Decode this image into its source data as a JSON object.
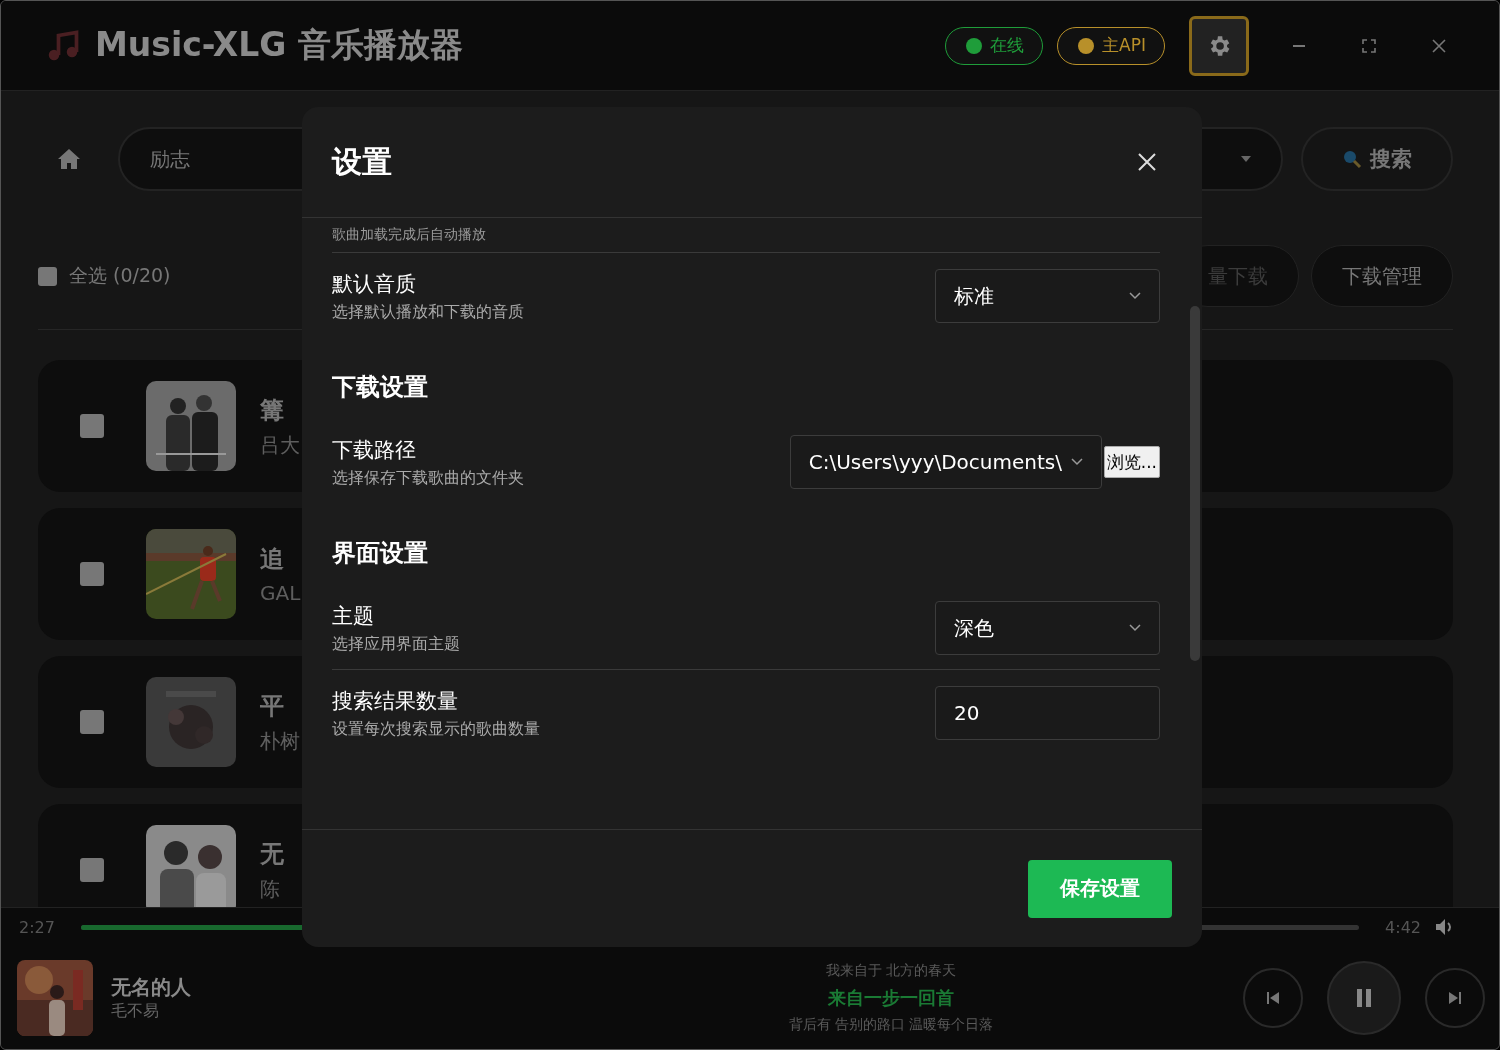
{
  "window": {
    "title": "Music-XLG 音乐播放器",
    "status": [
      {
        "label": "在线",
        "color": "#1f9d3a"
      },
      {
        "label": "主API",
        "color": "#b8902a"
      }
    ]
  },
  "search": {
    "query": "励志",
    "button": "搜索"
  },
  "toolbar": {
    "select_all": {
      "label": "全选 (0/20)",
      "checked": false
    },
    "buttons": [
      "量下载",
      "下载管理"
    ]
  },
  "songs": [
    {
      "title": "篝",
      "artist": "吕大",
      "checked": false
    },
    {
      "title": "追",
      "artist": "GAL",
      "checked": false
    },
    {
      "title": "平",
      "artist": "朴树",
      "checked": false
    },
    {
      "title": "无",
      "artist": "陈",
      "checked": false
    }
  ],
  "settings": {
    "title": "设置",
    "partial_note": "歌曲加载完成后自动播放",
    "sections": [
      {
        "rows": [
          {
            "kind": "select",
            "label": "默认音质",
            "description": "选择默认播放和下载的音质",
            "value": "标准"
          }
        ]
      },
      {
        "heading": "下载设置",
        "rows": [
          {
            "kind": "path",
            "label": "下载路径",
            "description": "选择保存下载歌曲的文件夹",
            "value": "C:\\Users\\yyy\\Documents\\",
            "button": "浏览..."
          }
        ]
      },
      {
        "heading": "界面设置",
        "rows": [
          {
            "kind": "select",
            "label": "主题",
            "description": "选择应用界面主题",
            "value": "深色"
          },
          {
            "kind": "input",
            "label": "搜索结果数量",
            "description": "设置每次搜索显示的歌曲数量",
            "value": "20"
          }
        ]
      }
    ],
    "save": "保存设置"
  },
  "player": {
    "elapsed": "2:27",
    "duration": "4:42",
    "level": 0.52,
    "title": "无名的人",
    "artist": "毛不易",
    "lyrics": [
      {
        "text": "我来自于 北方的春天",
        "selected": false
      },
      {
        "text": "来自一步一回首",
        "selected": true
      },
      {
        "text": "背后有 告别的路口 温暖每个日落",
        "selected": false
      }
    ],
    "playing": true
  }
}
